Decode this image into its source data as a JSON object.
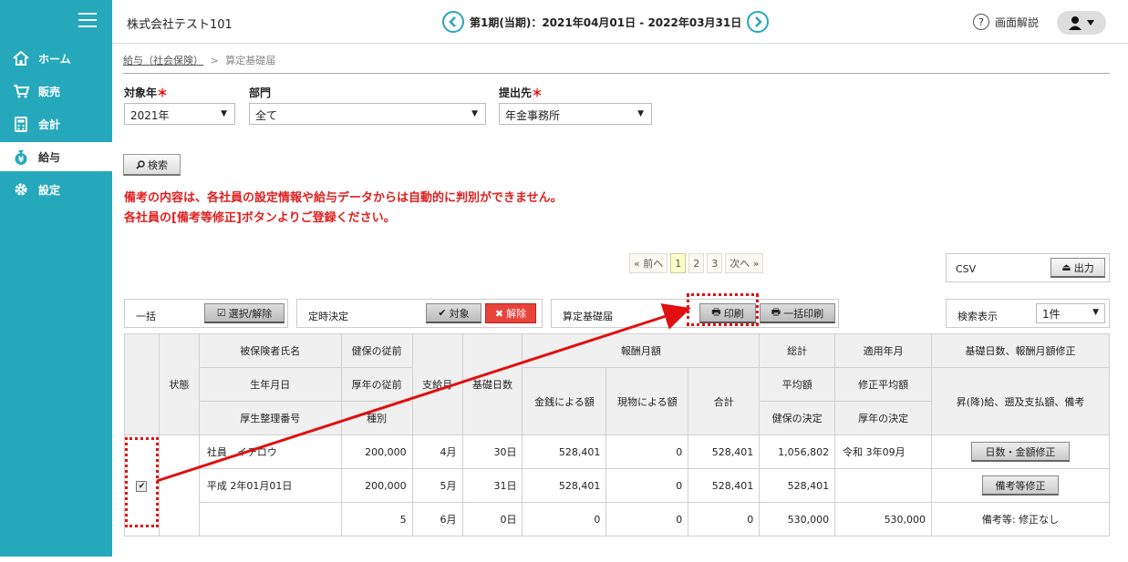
{
  "sidebar": {
    "items": [
      {
        "label": "ホーム",
        "icon": "home-icon"
      },
      {
        "label": "販売",
        "icon": "cart-icon"
      },
      {
        "label": "会計",
        "icon": "calculator-icon"
      },
      {
        "label": "給与",
        "icon": "money-bag-icon"
      },
      {
        "label": "設定",
        "icon": "gear-icon"
      }
    ],
    "active": "給与"
  },
  "header": {
    "company": "株式会社テスト101",
    "period": "第1期(当期)：2021年04月01日 - 2022年03月31日",
    "help": "画面解説"
  },
  "breadcrumb": {
    "link": "給与（社会保険）",
    "separator": ">",
    "current": "算定基礎届"
  },
  "filters": {
    "year": {
      "label": "対象年",
      "value": "2021年",
      "required": "＊"
    },
    "dept": {
      "label": "部門",
      "value": "全て"
    },
    "dest": {
      "label": "提出先",
      "value": "年金事務所",
      "required": "＊"
    }
  },
  "search_label": "検索",
  "notice": {
    "line1": "備考の内容は、各社員の設定情報や給与データからは自動的に判別ができません。",
    "line2": "各社員の[備考等修正]ボタンよりご登録ください。"
  },
  "pager": {
    "prev": "« 前へ",
    "pages": [
      "1",
      "2",
      "3"
    ],
    "next": "次へ »"
  },
  "csv": {
    "label": "CSV",
    "button": "出力"
  },
  "actions": {
    "bulk_label": "一括",
    "select_toggle": "選択/解除",
    "regular_label": "定時決定",
    "target": "対象",
    "cancel": "解除",
    "form_label": "算定基礎届",
    "print": "印刷",
    "bulk_print": "一括印刷",
    "display_label": "検索表示",
    "display_value": "1件"
  },
  "table": {
    "headers": {
      "status": "状態",
      "name": "被保険者氏名",
      "birth": "生年月日",
      "pension_no": "厚生整理番号",
      "health_prev": "健保の従前",
      "pension_prev": "厚年の従前",
      "kind": "種別",
      "pay_month": "支給月",
      "base_days": "基礎日数",
      "remuneration": "報酬月額",
      "cash": "金銭による額",
      "kind_goods": "現物による額",
      "subtotal": "合計",
      "total": "総計",
      "average": "平均額",
      "health_decision": "健保の決定",
      "applied_month": "適用年月",
      "revised_avg": "修正平均額",
      "pension_decision": "厚年の決定",
      "revise_title": "基礎日数、報酬月額修正",
      "revise_sub": "昇(降)給、遡及支払額、備考"
    },
    "employee": {
      "name": "社員　イチロウ",
      "birth": "平成 2年01月01日",
      "health_prev": "200,000",
      "pension_prev": "200,000",
      "kind": "5",
      "rows": [
        {
          "month": "4月",
          "days": "30日",
          "cash": "528,401",
          "goods": "0",
          "sum": "528,401"
        },
        {
          "month": "5月",
          "days": "31日",
          "cash": "528,401",
          "goods": "0",
          "sum": "528,401"
        },
        {
          "month": "6月",
          "days": "0日",
          "cash": "0",
          "goods": "0",
          "sum": "0"
        }
      ],
      "total": "1,056,802",
      "average": "528,401",
      "health_decision": "530,000",
      "applied_month": "令和 3年09月",
      "pension_decision": "530,000",
      "btn_days": "日数・金額修正",
      "btn_remarks": "備考等修正",
      "remarks": "備考等: 修正なし"
    }
  },
  "colors": {
    "sidebar": "#25a8bb",
    "accent_red": "#e02020",
    "cancel_red": "#e8433a"
  }
}
